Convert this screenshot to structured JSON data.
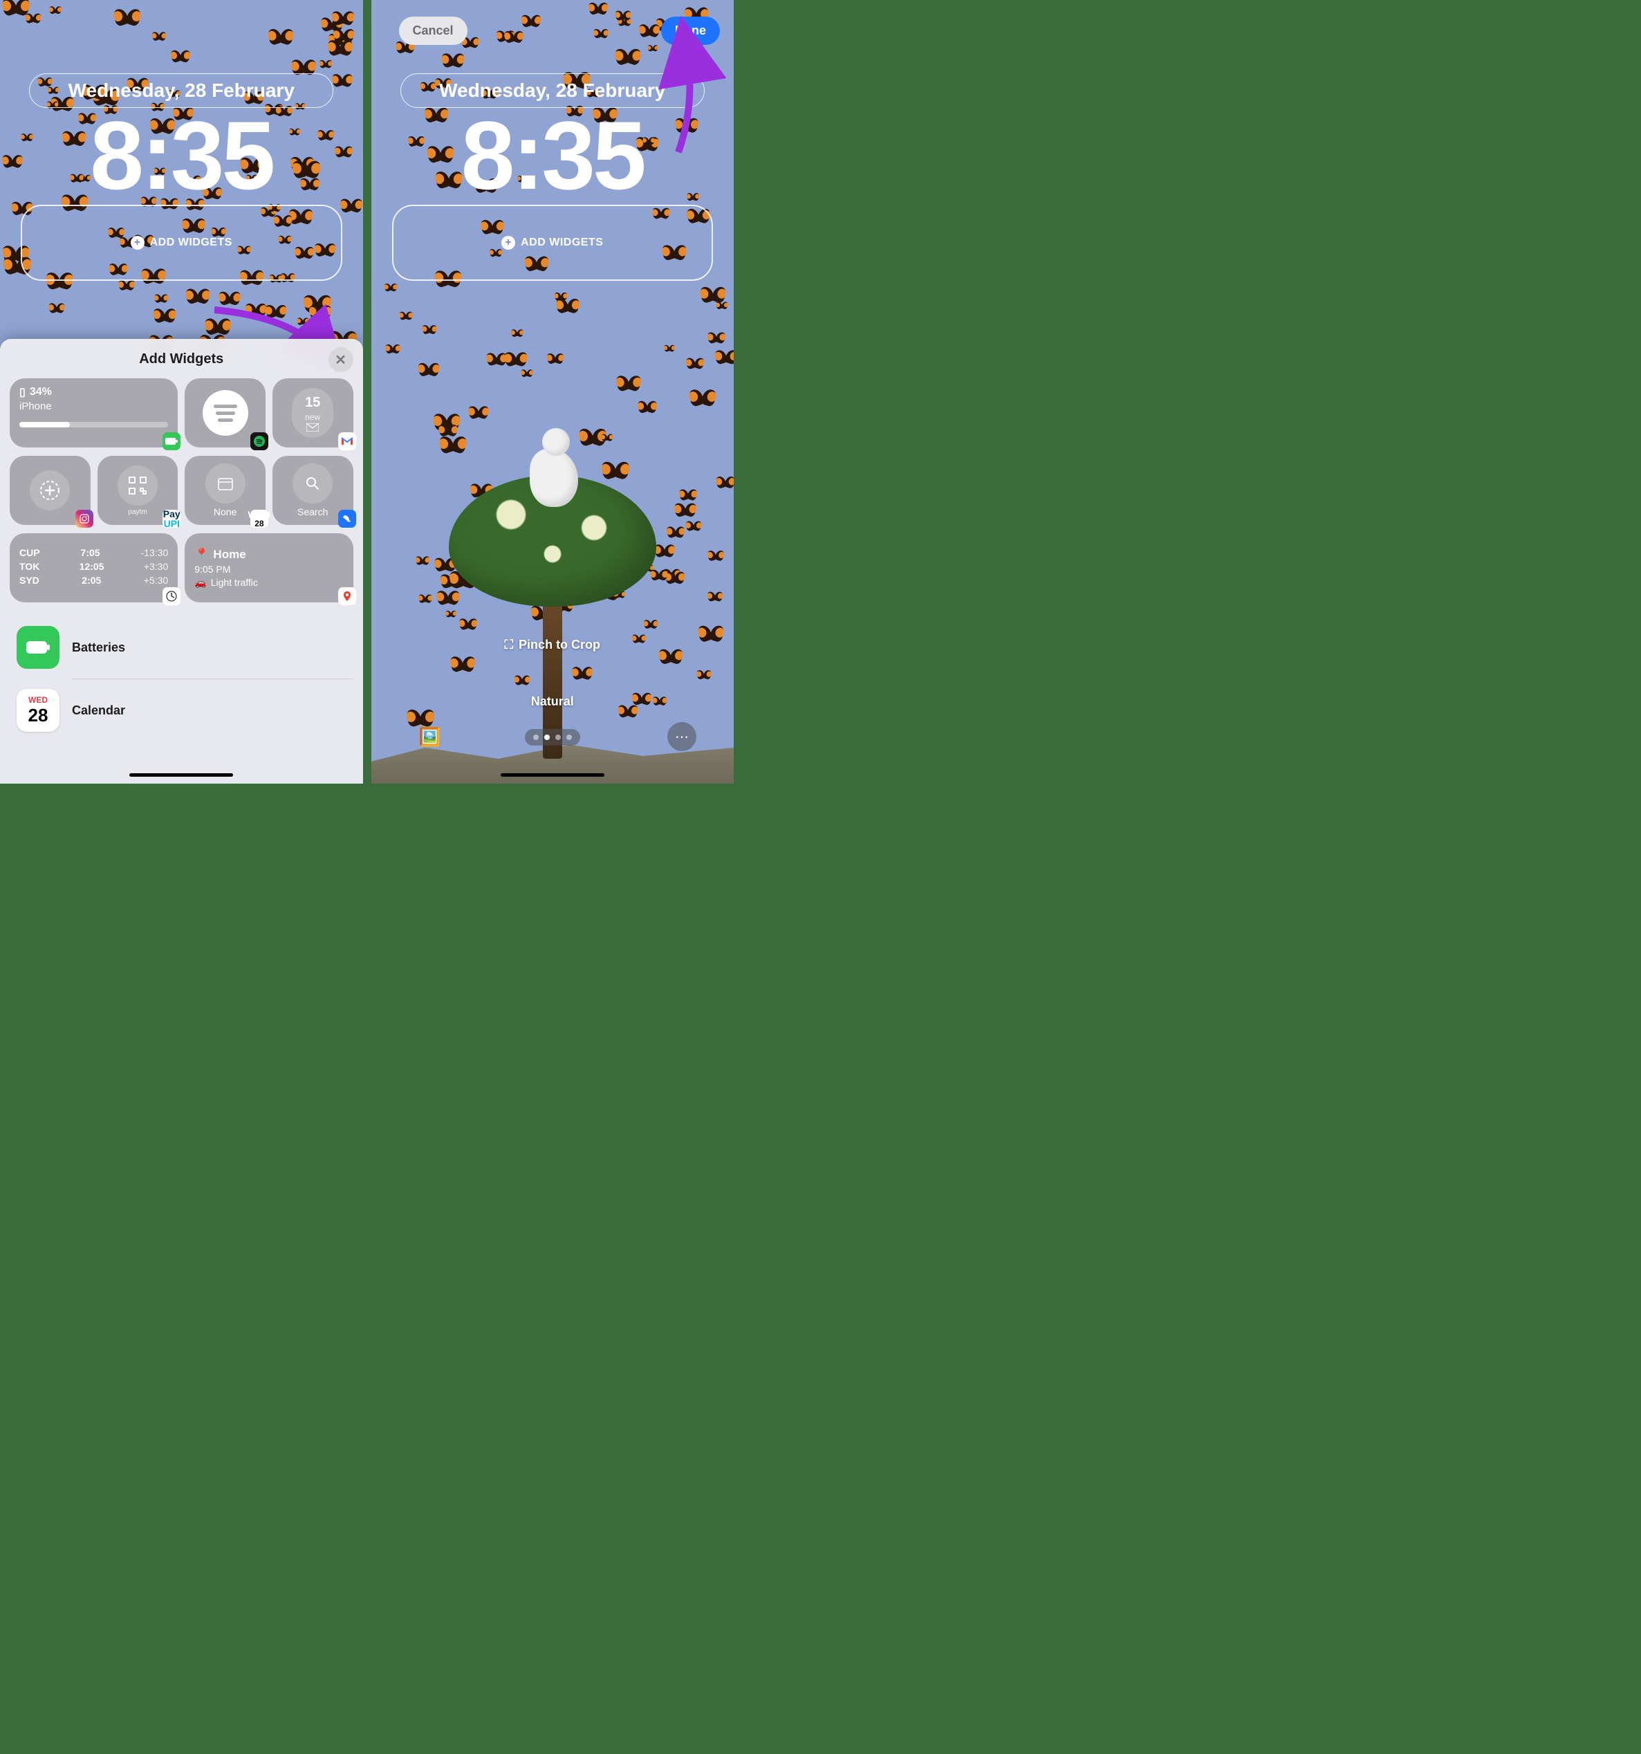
{
  "date": "Wednesday, 28 February",
  "time": "8:35",
  "add_widgets_label": "ADD WIDGETS",
  "left": {
    "sheet_title": "Add Widgets",
    "widgets": {
      "battery": {
        "percent": "34%",
        "device": "iPhone"
      },
      "gmail": {
        "count": "15",
        "label": "new"
      },
      "calendar": {
        "label": "None"
      },
      "search": {
        "label": "Search"
      },
      "clocks": [
        {
          "city": "CUP",
          "time": "7:05",
          "offset": "-13:30"
        },
        {
          "city": "TOK",
          "time": "12:05",
          "offset": "+3:30"
        },
        {
          "city": "SYD",
          "time": "2:05",
          "offset": "+5:30"
        }
      ],
      "maps": {
        "title": "Home",
        "time": "9:05 PM",
        "traffic": "Light traffic"
      },
      "cal_mini": {
        "dow": "WED",
        "day": "28"
      }
    },
    "apps": {
      "batteries": "Batteries",
      "calendar": "Calendar",
      "cal_icon": {
        "dow": "WED",
        "day": "28"
      }
    }
  },
  "right": {
    "cancel": "Cancel",
    "done": "Done",
    "pinch": "Pinch to Crop",
    "style": "Natural",
    "dots": 4,
    "active_dot": 1
  }
}
